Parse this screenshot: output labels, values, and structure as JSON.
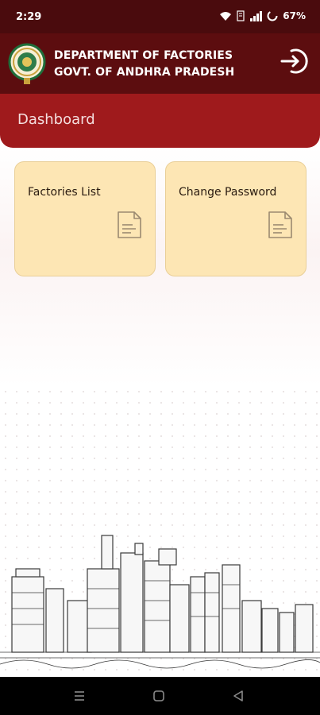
{
  "status_bar": {
    "time": "2:29",
    "battery": "67%",
    "icons": [
      "wifi-icon",
      "volte-icon",
      "signal-icon",
      "battery-icon"
    ]
  },
  "header": {
    "title_line1": "DEPARTMENT OF FACTORIES",
    "title_line2": "GOVT. OF ANDHRA PRADESH",
    "logo": "andhra-pradesh-emblem",
    "logout_icon": "logout-icon"
  },
  "dashboard": {
    "title": "Dashboard"
  },
  "cards": [
    {
      "label": "Factories List",
      "icon": "document-icon"
    },
    {
      "label": "Change Password",
      "icon": "document-icon"
    }
  ],
  "nav": {
    "buttons": [
      "menu-icon",
      "home-icon",
      "back-icon"
    ]
  },
  "colors": {
    "header_bg": "#5c0d0f",
    "dashboard_bg": "#9f1a1c",
    "card_bg": "#fde6b4"
  }
}
